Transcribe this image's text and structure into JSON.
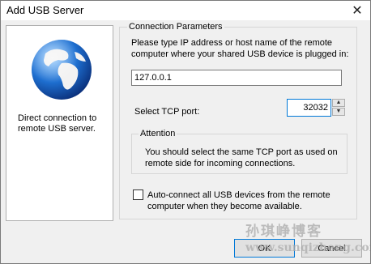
{
  "window": {
    "title": "Add USB Server"
  },
  "left_panel": {
    "description": "Direct connection to remote USB server."
  },
  "connection": {
    "group_label": "Connection Parameters",
    "instruction": "Please type IP address or host name of the remote computer where your shared USB device is plugged in:",
    "ip_value": "127.0.0.1",
    "port_label": "Select TCP port:",
    "port_value": "32032"
  },
  "attention": {
    "label": "Attention",
    "text": "You should select the same TCP port as used on remote side for incoming connections."
  },
  "auto_connect": {
    "label": "Auto-connect all USB devices from the remote computer when they become available.",
    "checked": false
  },
  "buttons": {
    "ok_label": "OK",
    "cancel_label": "Cancel"
  },
  "watermark": {
    "line1": "孙琪峥博客",
    "line2": "www.sunqizheng.com"
  },
  "icons": {
    "close": "close-icon",
    "globe": "globe-icon",
    "spin_up": "spin-up-icon",
    "spin_down": "spin-down-icon"
  },
  "colors": {
    "window_bg": "#f0f0f0",
    "focus_border": "#0078d7",
    "globe_ocean": "#1e6fd0",
    "globe_land": "#f2f2f2"
  }
}
